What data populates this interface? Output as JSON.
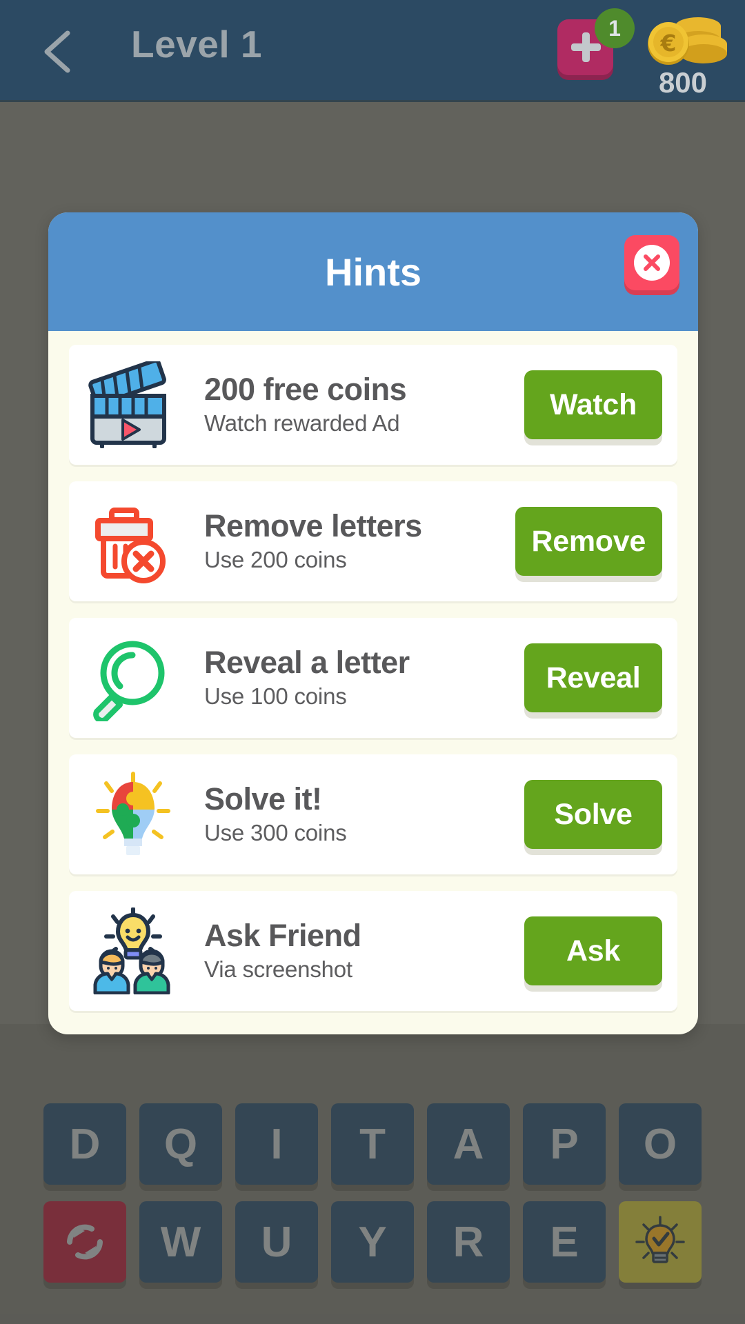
{
  "topbar": {
    "back_icon": "chevron-left-icon",
    "title": "Level 1",
    "add_icon": "plus-icon",
    "badge_count": "1",
    "coins_icon": "coin-stack-icon",
    "coins_amount": "800"
  },
  "dialog": {
    "title": "Hints",
    "close_icon": "close-x-icon",
    "header_color": "#5390cb",
    "body_color": "#fbfbec",
    "button_color": "#64a51d",
    "close_color": "#fb4a62",
    "hints": [
      {
        "icon": "clapperboard-video-icon",
        "title": "200 free coins",
        "subtitle": "Watch rewarded Ad",
        "button": "Watch"
      },
      {
        "icon": "trash-delete-icon",
        "title": "Remove letters",
        "subtitle": "Use 200 coins",
        "button": "Remove"
      },
      {
        "icon": "magnifier-search-icon",
        "title": "Reveal a letter",
        "subtitle": "Use 100 coins",
        "button": "Reveal"
      },
      {
        "icon": "puzzle-lightbulb-icon",
        "title": "Solve it!",
        "subtitle": "Use 300 coins",
        "button": "Solve"
      },
      {
        "icon": "friends-idea-icon",
        "title": "Ask Friend",
        "subtitle": "Via screenshot",
        "button": "Ask"
      }
    ]
  },
  "keyboard": {
    "row1": [
      "D",
      "Q",
      "I",
      "T",
      "A",
      "P",
      "O"
    ],
    "row2_letters": [
      "W",
      "U",
      "Y",
      "R",
      "E"
    ],
    "shuffle_icon": "shuffle-refresh-icon",
    "hint_icon": "lightbulb-hint-icon",
    "key_color": "#2d4f6e",
    "shuffle_color": "#ad2340",
    "hint_color": "#c0b83e"
  }
}
